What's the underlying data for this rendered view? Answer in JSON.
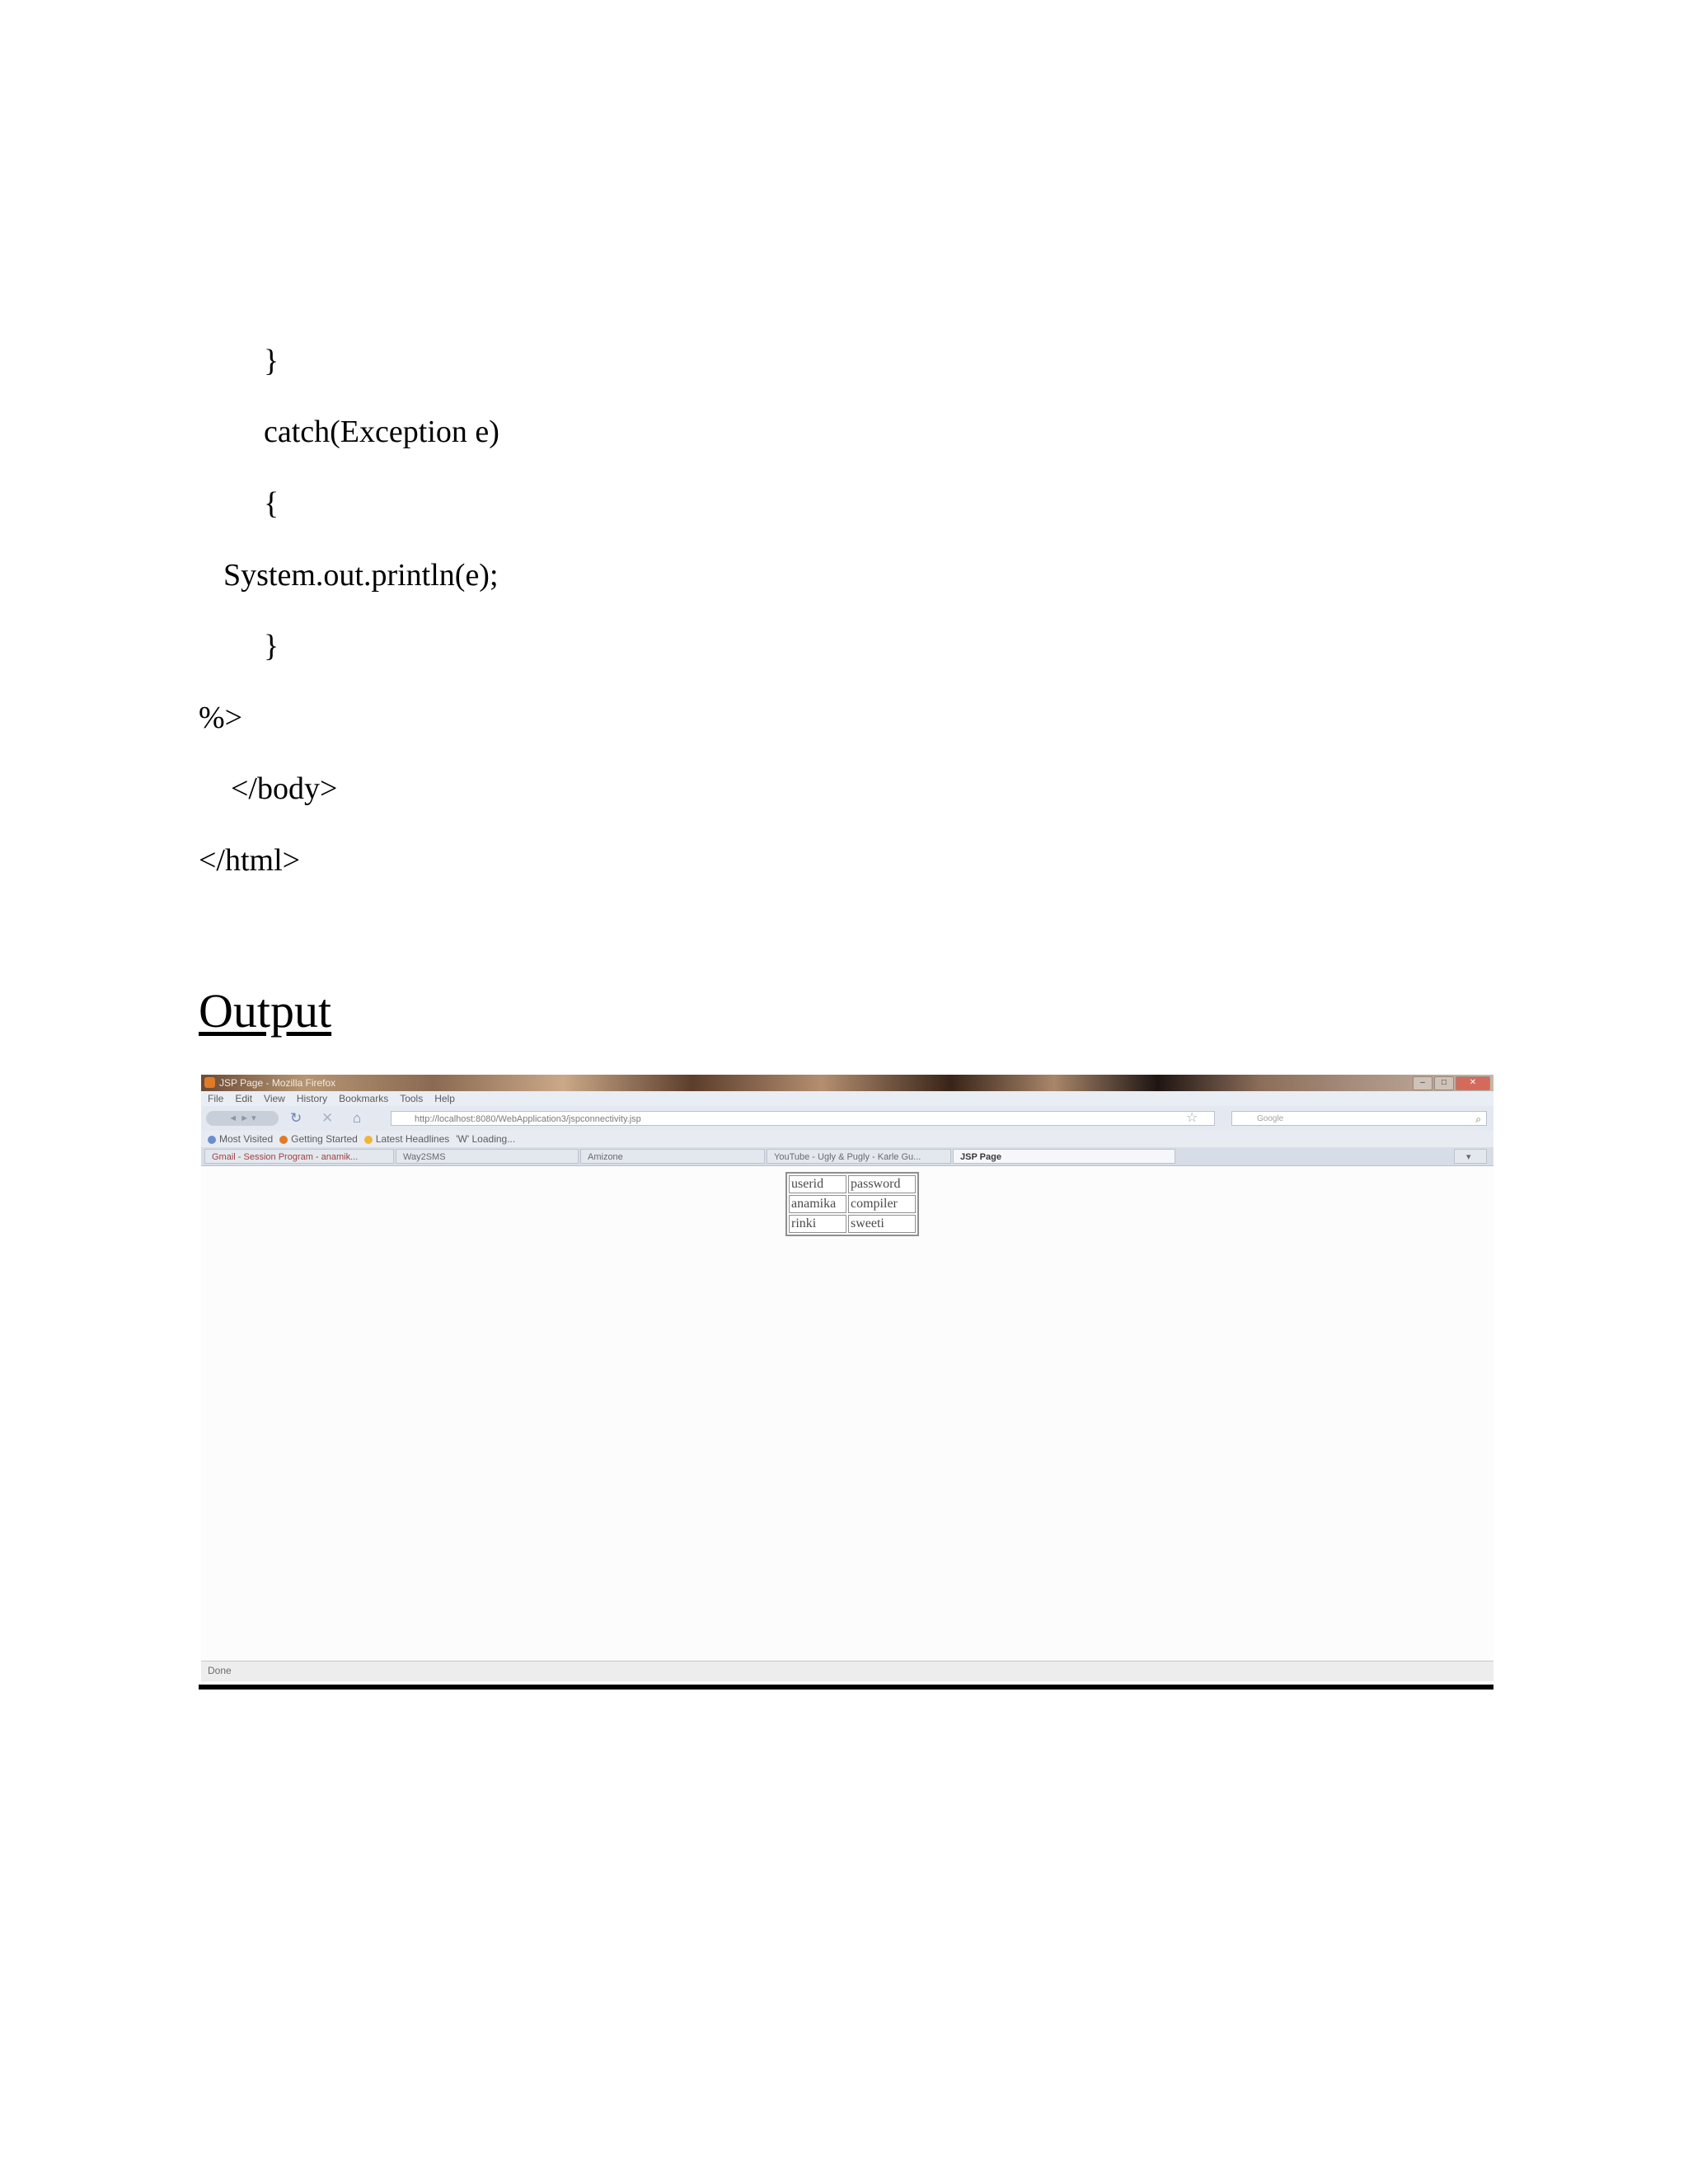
{
  "code_lines": [
    "}",
    "catch(Exception e)",
    "{",
    "System.out.println(e);",
    "}",
    "%>",
    "</body>",
    "</html>"
  ],
  "output_heading": "Output",
  "browser": {
    "window_title": "JSP Page - Mozilla Firefox",
    "window_buttons": [
      "–",
      "□",
      "✕"
    ],
    "menu": [
      "File",
      "Edit",
      "View",
      "History",
      "Bookmarks",
      "Tools",
      "Help"
    ],
    "nav": {
      "back_forward_label": "◄ ► ▾",
      "reload_icon": "reload-icon",
      "stop_icon": "stop-icon",
      "home_icon": "home-icon"
    },
    "url": "http://localhost:8080/WebApplication3/jspconnectivity.jsp",
    "search_placeholder": "Google",
    "bookmarks": [
      {
        "label": "Most Visited",
        "color": "#6a8fd0"
      },
      {
        "label": "Getting Started",
        "color": "#e07a26"
      },
      {
        "label": "Latest Headlines",
        "color": "#f0b43a"
      },
      {
        "label": "'W' Loading...",
        "color": "#888888"
      }
    ],
    "tabs": [
      {
        "label": "Gmail - Session Program - anamik...",
        "active": false
      },
      {
        "label": "Way2SMS",
        "active": false
      },
      {
        "label": "Amizone",
        "active": false
      },
      {
        "label": "YouTube - Ugly & Pugly - Karle Gu...",
        "active": false
      },
      {
        "label": "JSP Page",
        "active": true
      }
    ],
    "table": {
      "header": [
        "userid",
        "password"
      ],
      "rows": [
        [
          "anamika",
          "compiler"
        ],
        [
          "rinki",
          "sweeti"
        ]
      ]
    },
    "status": "Done"
  }
}
